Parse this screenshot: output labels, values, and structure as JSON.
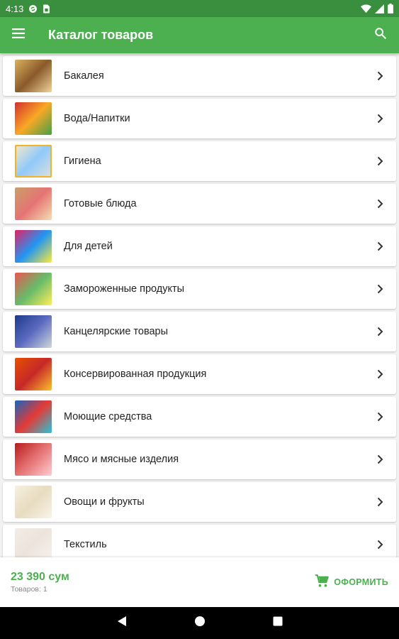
{
  "status_bar": {
    "time": "4:13",
    "icons": [
      "sync-icon",
      "sim-card-icon",
      "wifi-icon",
      "signal-icon",
      "battery-icon"
    ]
  },
  "app_bar": {
    "title": "Каталог товаров",
    "menu_icon": "hamburger-menu-icon",
    "search_icon": "search-icon"
  },
  "categories": [
    {
      "label": "Бакалея",
      "thumb_colors": [
        "#d9b25e",
        "#8a5a2b",
        "#f0d49a"
      ]
    },
    {
      "label": "Вода/Напитки",
      "thumb_colors": [
        "#d32f2f",
        "#f9a825",
        "#43a047"
      ]
    },
    {
      "label": "Гигиена",
      "thumb_colors": [
        "#fbe9c7",
        "#90caf9",
        "#e0e0e0"
      ]
    },
    {
      "label": "Готовые блюда",
      "thumb_colors": [
        "#c8a06a",
        "#e57373",
        "#f5deb3"
      ]
    },
    {
      "label": "Для детей",
      "thumb_colors": [
        "#e91e63",
        "#2196f3",
        "#ffeb3b"
      ]
    },
    {
      "label": "Замороженные продукты",
      "thumb_colors": [
        "#ef5350",
        "#66bb6a",
        "#ffee58"
      ]
    },
    {
      "label": "Канцелярские товары",
      "thumb_colors": [
        "#1e3a8a",
        "#5c6bc0",
        "#cfd8dc"
      ]
    },
    {
      "label": "Консервированная продукция",
      "thumb_colors": [
        "#e65100",
        "#c62828",
        "#fbc02d"
      ]
    },
    {
      "label": "Моющие средства",
      "thumb_colors": [
        "#1565c0",
        "#e53935",
        "#26c6da"
      ]
    },
    {
      "label": "Мясо и мясные изделия",
      "thumb_colors": [
        "#b71c1c",
        "#e57373",
        "#ffcdd2"
      ]
    },
    {
      "label": "Овощи и фрукты",
      "thumb_colors": [
        "#f5f0e0",
        "#e8dcc0",
        "#f8f4e8"
      ]
    },
    {
      "label": "Текстиль",
      "thumb_colors": [
        "#f2ece6",
        "#ece4dc",
        "#f6f2ee"
      ]
    }
  ],
  "cart": {
    "total": "23 390 сум",
    "count_label": "Товаров: 1",
    "checkout_label": "ОФОРМИТЬ",
    "checkout_icon": "cart-icon"
  },
  "nav_bar": {
    "icons": [
      "back-icon",
      "home-icon",
      "recents-icon"
    ]
  },
  "colors": {
    "primary": "#4caf50",
    "status_bar": "#3a8f3f",
    "background": "#f2f2f2"
  }
}
